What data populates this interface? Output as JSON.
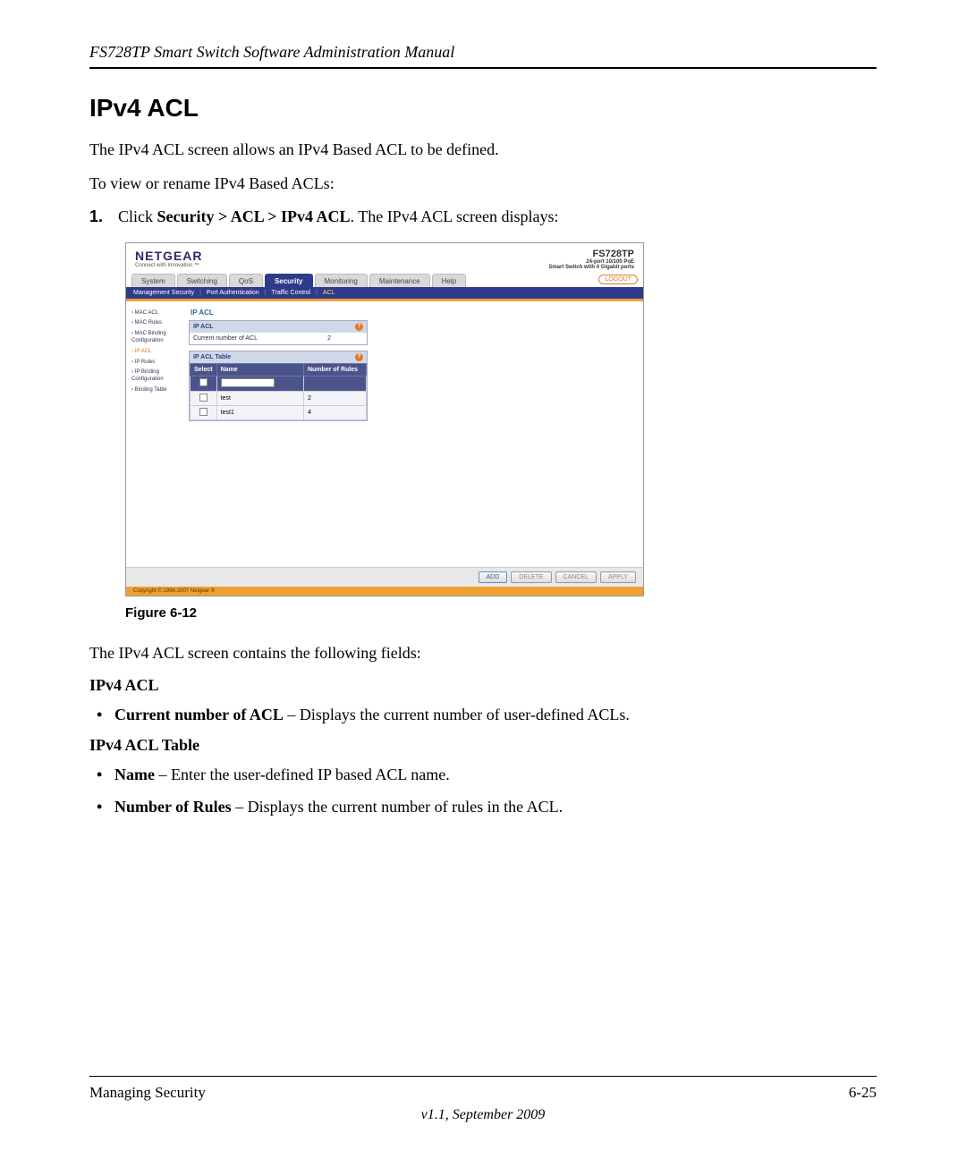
{
  "doc": {
    "header": "FS728TP Smart Switch Software Administration Manual",
    "section_title": "IPv4 ACL",
    "intro1": "The IPv4 ACL screen allows an IPv4 Based ACL to be defined.",
    "intro2": "To view or rename IPv4 Based ACLs:",
    "step_num": "1.",
    "step_prefix": "Click ",
    "step_bold": "Security > ACL > IPv4 ACL",
    "step_suffix": ". The IPv4 ACL screen displays:",
    "figure_caption": "Figure 6-12",
    "after_figure": "The IPv4 ACL screen contains the following fields:",
    "heading_ipv4_acl": "IPv4 ACL",
    "bullet_current_bold": "Current number of ACL",
    "bullet_current_rest": " – Displays the current number of user-defined ACLs.",
    "heading_ipv4_acl_table": "IPv4 ACL Table",
    "bullet_name_bold": "Name",
    "bullet_name_rest": " – Enter the user-defined IP based ACL name.",
    "bullet_rules_bold": "Number of Rules",
    "bullet_rules_rest": " – Displays the current number of rules in the ACL.",
    "footer_left": "Managing Security",
    "footer_right": "6-25",
    "footer_version": "v1.1, September 2009"
  },
  "screenshot": {
    "brand": "NETGEAR",
    "brand_tag": "Connect with Innovation ™",
    "model": "FS728TP",
    "model_sub1": "24-port 10/100 PoE",
    "model_sub2": "Smart Switch with 4 Gigabit ports",
    "logout": "LOGOUT",
    "tabs": {
      "system": "System",
      "switching": "Switching",
      "qos": "QoS",
      "security": "Security",
      "monitoring": "Monitoring",
      "maintenance": "Maintenance",
      "help": "Help"
    },
    "subnav": {
      "mgmt": "Management Security",
      "portauth": "Port Authentication",
      "traffic": "Traffic Control",
      "acl": "ACL"
    },
    "sidebar": {
      "mac_acl": "MAC ACL",
      "mac_rules": "MAC Rules",
      "mac_binding": "MAC Binding Configuration",
      "ip_acl": "IP ACL",
      "ip_rules": "IP Rules",
      "ip_binding": "IP Binding Configuration",
      "binding_table": "Binding Table"
    },
    "panel_title": "IP ACL",
    "box1": {
      "head": "IP ACL",
      "row_label": "Current number of ACL",
      "row_value": "2"
    },
    "box2_head": "IP ACL Table",
    "table": {
      "col_select": "Select",
      "col_name": "Name",
      "col_rules": "Number of Rules",
      "rows": [
        {
          "name": "test",
          "rules": "2"
        },
        {
          "name": "test1",
          "rules": "4"
        }
      ]
    },
    "buttons": {
      "add": "ADD",
      "delete": "DELETE",
      "cancel": "CANCEL",
      "apply": "APPLY"
    },
    "copyright": "Copyright © 1996-2007 Netgear ®"
  }
}
